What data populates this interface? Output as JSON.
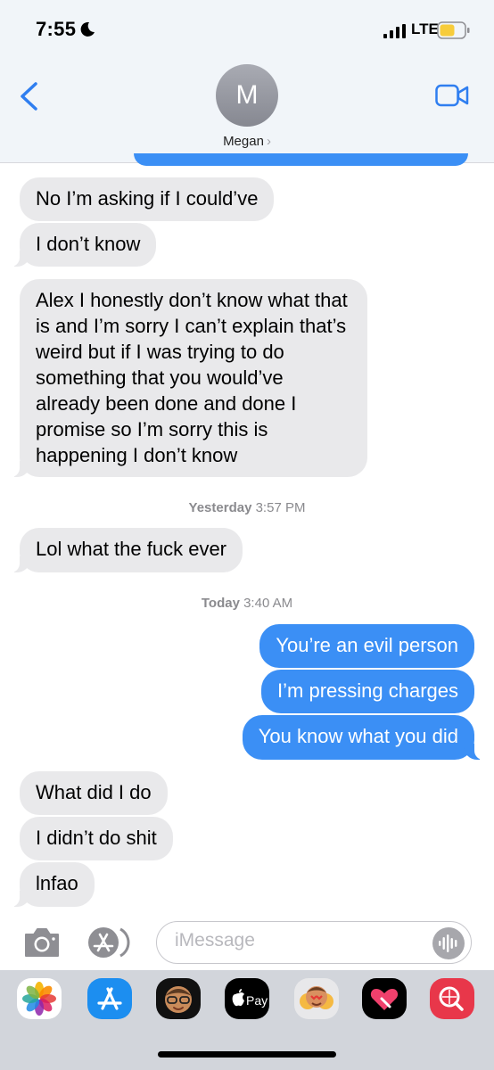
{
  "status_bar": {
    "time": "7:55",
    "network": "LTE"
  },
  "header": {
    "avatar_initial": "M",
    "contact_name": "Megan",
    "chevron": "›"
  },
  "messages": [
    {
      "dir": "in",
      "text": "No I’m asking if I could’ve"
    },
    {
      "dir": "in",
      "text": "I don’t know"
    },
    {
      "dir": "in",
      "text": "Alex I honestly don’t know what that is and I’m sorry I can’t explain that’s weird but if I was trying to do something that you would’ve already been done and done I promise so I’m sorry this is happening I don’t know"
    },
    {
      "dir": "in",
      "text": "Lol what the fuck ever"
    },
    {
      "dir": "out",
      "text": "You’re an evil person"
    },
    {
      "dir": "out",
      "text": "I’m pressing charges"
    },
    {
      "dir": "out",
      "text": "You know what you did"
    },
    {
      "dir": "in",
      "text": "What did I do"
    },
    {
      "dir": "in",
      "text": "I didn’t do shit"
    },
    {
      "dir": "in",
      "text": "lnfao"
    }
  ],
  "timestamps": [
    {
      "day": "Yesterday",
      "time": "3:57 PM"
    },
    {
      "day": "Today",
      "time": "3:40 AM"
    }
  ],
  "composer": {
    "placeholder": "iMessage"
  },
  "app_drawer": {
    "apps": [
      "photos-icon",
      "app-store-icon",
      "memoji-icon",
      "apple-pay-icon",
      "memoji-stickers-icon",
      "digital-touch-icon",
      "image-search-icon"
    ],
    "pay_label": "Pay"
  },
  "colors": {
    "outgoing": "#3b8ff5",
    "incoming": "#e9e9eb",
    "header_bg": "#f1f5f9",
    "accent": "#2f7ef0"
  }
}
